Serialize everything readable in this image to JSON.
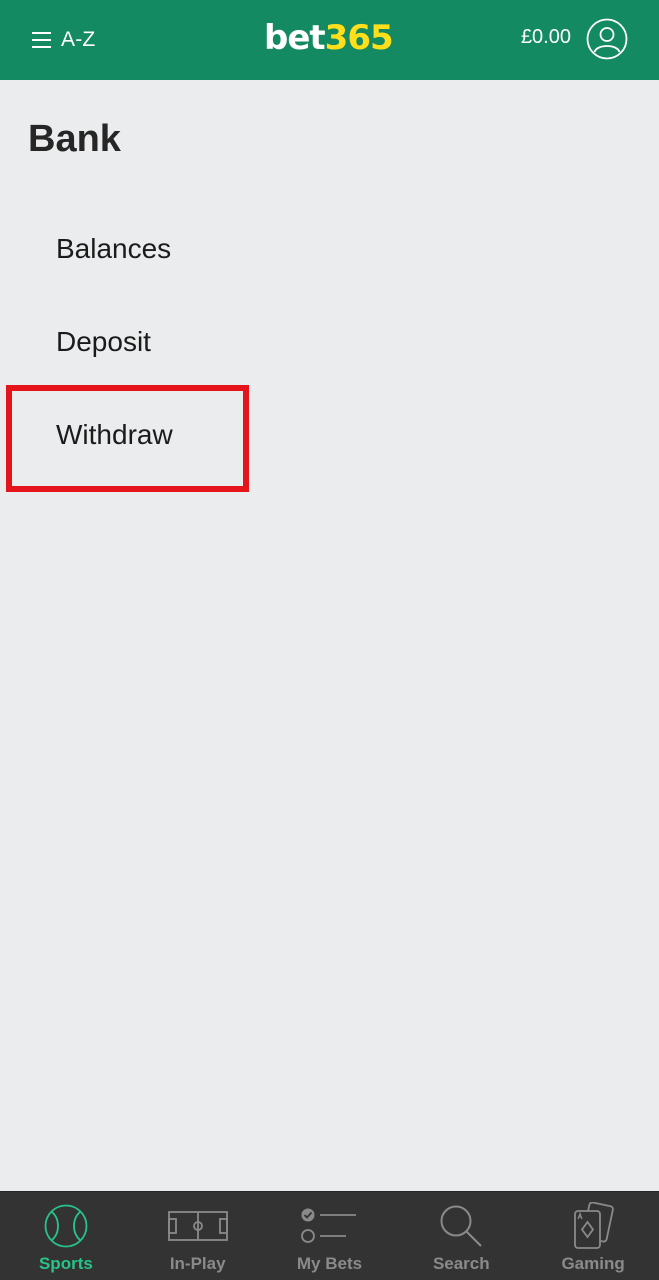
{
  "header": {
    "menu_label": "A-Z",
    "logo_part1": "bet",
    "logo_part2": "365",
    "balance": "£0.00"
  },
  "page": {
    "title": "Bank"
  },
  "menu": {
    "items": [
      {
        "label": "Balances"
      },
      {
        "label": "Deposit"
      },
      {
        "label": "Withdraw",
        "highlighted": true
      }
    ]
  },
  "bottom_nav": {
    "active": "Sports",
    "items": [
      {
        "label": "Sports",
        "icon": "sports-ball-icon"
      },
      {
        "label": "In-Play",
        "icon": "pitch-icon"
      },
      {
        "label": "My Bets",
        "icon": "bet-list-icon"
      },
      {
        "label": "Search",
        "icon": "search-icon"
      },
      {
        "label": "Gaming",
        "icon": "playing-cards-icon"
      }
    ]
  },
  "colors": {
    "header_bg": "#138a62",
    "logo_accent": "#ffdf1b",
    "page_bg": "#ebeced",
    "highlight": "#e5141b",
    "nav_bg": "#333333",
    "nav_active": "#27c48a",
    "nav_inactive": "#8a8a8a"
  }
}
